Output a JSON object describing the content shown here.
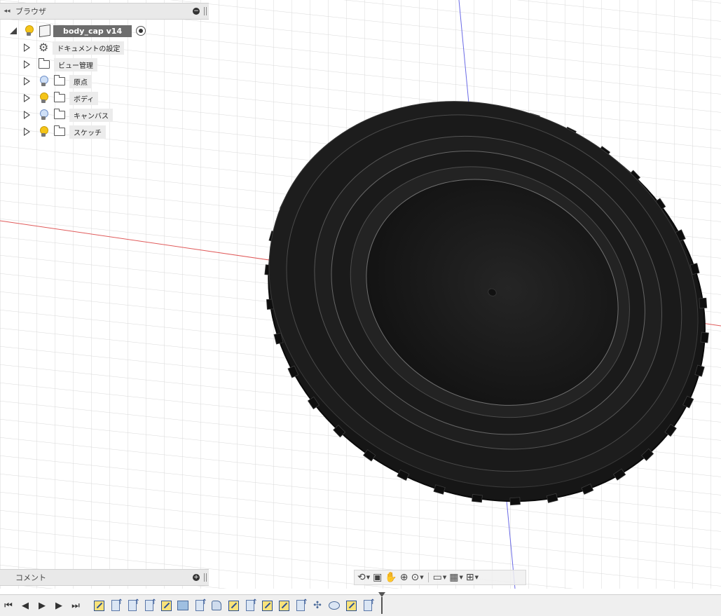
{
  "browser": {
    "title": "ブラウザ",
    "document": {
      "label": "body_cap v14"
    },
    "items": [
      {
        "label": "ドキュメントの設定",
        "icon": "gear-icon",
        "bulb": "none"
      },
      {
        "label": "ビュー管理",
        "icon": "folder-icon",
        "bulb": "none"
      },
      {
        "label": "原点",
        "icon": "folder-icon",
        "bulb": "off"
      },
      {
        "label": "ボディ",
        "icon": "folder-icon",
        "bulb": "on"
      },
      {
        "label": "キャンバス",
        "icon": "folder-icon",
        "bulb": "off"
      },
      {
        "label": "スケッチ",
        "icon": "folder-icon",
        "bulb": "on"
      }
    ]
  },
  "comments": {
    "title": "コメント"
  },
  "navbar": {
    "tools": [
      "orbit-icon",
      "look-at-icon",
      "pan-icon",
      "zoom-icon",
      "fit-icon",
      "display-settings-icon",
      "grid-icon",
      "viewports-icon"
    ]
  },
  "timeline": {
    "controls": [
      "go-to-start-icon",
      "step-back-icon",
      "play-icon",
      "step-forward-icon",
      "go-to-end-icon"
    ],
    "features": [
      "sketch",
      "extrude",
      "extrude",
      "extrude",
      "sketch",
      "canvas",
      "extrude",
      "body",
      "sketch",
      "extrude",
      "sketch",
      "sketch",
      "extrude",
      "pattern",
      "revolve",
      "sketch",
      "extrude"
    ]
  },
  "colors": {
    "model": "#1e1e1e",
    "x_axis": "#e04848",
    "y_axis": "#5a5ae0",
    "grid": "#d6d6d6",
    "panel": "#e9e9e9"
  }
}
